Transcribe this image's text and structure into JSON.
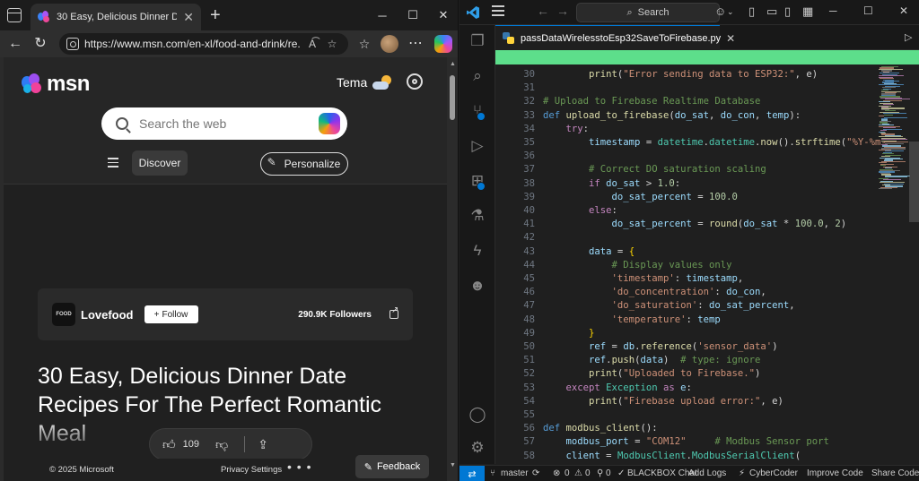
{
  "edge": {
    "tab_title": "30 Easy, Delicious Dinner Date Re",
    "url": "https://www.msn.com/en-xl/food-and-drink/re...",
    "window_controls": {
      "minimize": "─",
      "maximize": "☐",
      "close": "✕"
    },
    "msn": {
      "logo_text": "msn",
      "weather_label": "Tema",
      "search_placeholder": "Search the web",
      "discover_label": "Discover",
      "personalize_label": "Personalize",
      "publisher": {
        "logo_text": "FOOD",
        "name": "Lovefood",
        "follow_label": "Follow",
        "followers_count": "290.9K",
        "followers_label": "Followers"
      },
      "article_title": "30 Easy, Delicious Dinner Date Recipes For The Perfect Romantic Meal",
      "likes_count": "109",
      "copyright": "© 2025 Microsoft",
      "privacy": "Privacy Settings",
      "more": "• • •",
      "feedback": "Feedback"
    }
  },
  "vscode": {
    "search_label": "Search",
    "tab_title": "passDataWirelesstoEsp32SaveToFirebase.py",
    "code_lines": [
      {
        "n": "30",
        "tokens": [
          [
            "pl",
            "        "
          ],
          [
            "fn",
            "print"
          ],
          [
            "pl",
            "("
          ],
          [
            "str",
            "\"Error sending data to ESP32:\""
          ],
          [
            "pl",
            ", e)"
          ]
        ]
      },
      {
        "n": "31",
        "tokens": []
      },
      {
        "n": "32",
        "tokens": [
          [
            "cmt",
            "# Upload to Firebase Realtime Database"
          ]
        ]
      },
      {
        "n": "33",
        "tokens": [
          [
            "kw",
            "def "
          ],
          [
            "fn",
            "upload_to_firebase"
          ],
          [
            "pl",
            "("
          ],
          [
            "var",
            "do_sat"
          ],
          [
            "pl",
            ", "
          ],
          [
            "var",
            "do_con"
          ],
          [
            "pl",
            ", "
          ],
          [
            "var",
            "temp"
          ],
          [
            "pl",
            "):"
          ]
        ]
      },
      {
        "n": "34",
        "tokens": [
          [
            "pl",
            "    "
          ],
          [
            "ctl",
            "try"
          ],
          [
            "pl",
            ":"
          ]
        ]
      },
      {
        "n": "35",
        "tokens": [
          [
            "pl",
            "        "
          ],
          [
            "var",
            "timestamp"
          ],
          [
            "pl",
            " = "
          ],
          [
            "cls",
            "datetime"
          ],
          [
            "pl",
            "."
          ],
          [
            "cls",
            "datetime"
          ],
          [
            "pl",
            "."
          ],
          [
            "fn",
            "now"
          ],
          [
            "pl",
            "()."
          ],
          [
            "fn",
            "strftime"
          ],
          [
            "pl",
            "("
          ],
          [
            "str",
            "\"%Y-%m-"
          ]
        ]
      },
      {
        "n": "36",
        "tokens": []
      },
      {
        "n": "37",
        "tokens": [
          [
            "pl",
            "        "
          ],
          [
            "cmt",
            "# Correct DO saturation scaling"
          ]
        ]
      },
      {
        "n": "38",
        "tokens": [
          [
            "pl",
            "        "
          ],
          [
            "ctl",
            "if "
          ],
          [
            "var",
            "do_sat"
          ],
          [
            "pl",
            " > "
          ],
          [
            "num",
            "1.0"
          ],
          [
            "pl",
            ":"
          ]
        ]
      },
      {
        "n": "39",
        "tokens": [
          [
            "pl",
            "            "
          ],
          [
            "var",
            "do_sat_percent"
          ],
          [
            "pl",
            " = "
          ],
          [
            "num",
            "100.0"
          ]
        ]
      },
      {
        "n": "40",
        "tokens": [
          [
            "pl",
            "        "
          ],
          [
            "ctl",
            "else"
          ],
          [
            "pl",
            ":"
          ]
        ]
      },
      {
        "n": "41",
        "tokens": [
          [
            "pl",
            "            "
          ],
          [
            "var",
            "do_sat_percent"
          ],
          [
            "pl",
            " = "
          ],
          [
            "fn",
            "round"
          ],
          [
            "pl",
            "("
          ],
          [
            "var",
            "do_sat"
          ],
          [
            "pl",
            " * "
          ],
          [
            "num",
            "100.0"
          ],
          [
            "pl",
            ", "
          ],
          [
            "num",
            "2"
          ],
          [
            "pl",
            ")"
          ]
        ]
      },
      {
        "n": "42",
        "tokens": []
      },
      {
        "n": "43",
        "tokens": [
          [
            "pl",
            "        "
          ],
          [
            "var",
            "data"
          ],
          [
            "pl",
            " = "
          ],
          [
            "br",
            "{"
          ]
        ]
      },
      {
        "n": "44",
        "tokens": [
          [
            "pl",
            "            "
          ],
          [
            "cmt",
            "# Display values only"
          ]
        ]
      },
      {
        "n": "45",
        "tokens": [
          [
            "pl",
            "            "
          ],
          [
            "str",
            "'timestamp'"
          ],
          [
            "pl",
            ": "
          ],
          [
            "var",
            "timestamp"
          ],
          [
            "pl",
            ","
          ]
        ]
      },
      {
        "n": "46",
        "tokens": [
          [
            "pl",
            "            "
          ],
          [
            "str",
            "'do_concentration'"
          ],
          [
            "pl",
            ": "
          ],
          [
            "var",
            "do_con"
          ],
          [
            "pl",
            ","
          ]
        ]
      },
      {
        "n": "47",
        "tokens": [
          [
            "pl",
            "            "
          ],
          [
            "str",
            "'do_saturation'"
          ],
          [
            "pl",
            ": "
          ],
          [
            "var",
            "do_sat_percent"
          ],
          [
            "pl",
            ","
          ]
        ]
      },
      {
        "n": "48",
        "tokens": [
          [
            "pl",
            "            "
          ],
          [
            "str",
            "'temperature'"
          ],
          [
            "pl",
            ": "
          ],
          [
            "var",
            "temp"
          ]
        ]
      },
      {
        "n": "49",
        "tokens": [
          [
            "pl",
            "        "
          ],
          [
            "br",
            "}"
          ]
        ]
      },
      {
        "n": "50",
        "tokens": [
          [
            "pl",
            "        "
          ],
          [
            "var",
            "ref"
          ],
          [
            "pl",
            " = "
          ],
          [
            "var",
            "db"
          ],
          [
            "pl",
            "."
          ],
          [
            "fn",
            "reference"
          ],
          [
            "pl",
            "("
          ],
          [
            "str",
            "'sensor_data'"
          ],
          [
            "pl",
            ")"
          ]
        ]
      },
      {
        "n": "51",
        "tokens": [
          [
            "pl",
            "        "
          ],
          [
            "var",
            "ref"
          ],
          [
            "pl",
            "."
          ],
          [
            "fn",
            "push"
          ],
          [
            "pl",
            "("
          ],
          [
            "var",
            "data"
          ],
          [
            "pl",
            ")  "
          ],
          [
            "cmt",
            "# type: ignore"
          ]
        ]
      },
      {
        "n": "52",
        "tokens": [
          [
            "pl",
            "        "
          ],
          [
            "fn",
            "print"
          ],
          [
            "pl",
            "("
          ],
          [
            "str",
            "\"Uploaded to Firebase.\""
          ],
          [
            "pl",
            ")"
          ]
        ]
      },
      {
        "n": "53",
        "tokens": [
          [
            "pl",
            "    "
          ],
          [
            "ctl",
            "except "
          ],
          [
            "cls",
            "Exception "
          ],
          [
            "ctl",
            "as "
          ],
          [
            "var",
            "e"
          ],
          [
            "pl",
            ":"
          ]
        ]
      },
      {
        "n": "54",
        "tokens": [
          [
            "pl",
            "        "
          ],
          [
            "fn",
            "print"
          ],
          [
            "pl",
            "("
          ],
          [
            "str",
            "\"Firebase upload error:\""
          ],
          [
            "pl",
            ", e)"
          ]
        ]
      },
      {
        "n": "55",
        "tokens": []
      },
      {
        "n": "56",
        "tokens": [
          [
            "kw",
            "def "
          ],
          [
            "fn",
            "modbus_client"
          ],
          [
            "pl",
            "():"
          ]
        ]
      },
      {
        "n": "57",
        "tokens": [
          [
            "pl",
            "    "
          ],
          [
            "var",
            "modbus_port"
          ],
          [
            "pl",
            " = "
          ],
          [
            "str",
            "\"COM12\""
          ],
          [
            "pl",
            "     "
          ],
          [
            "cmt",
            "# Modbus Sensor port"
          ]
        ]
      },
      {
        "n": "58",
        "tokens": [
          [
            "pl",
            "    "
          ],
          [
            "var",
            "client"
          ],
          [
            "pl",
            " = "
          ],
          [
            "cls",
            "ModbusClient"
          ],
          [
            "pl",
            "."
          ],
          [
            "cls",
            "ModbusSerialClient"
          ],
          [
            "pl",
            "("
          ]
        ]
      }
    ],
    "status": {
      "branch": "master",
      "errors": "0",
      "warnings": "0",
      "ports": "0",
      "blackbox": "BLACKBOX Chat",
      "add_logs": "Add Logs",
      "cybercoder": "CyberCoder",
      "improve_code": "Improve Code",
      "share_code": "Share Code"
    },
    "colors": {
      "accent": "#0078d4",
      "notify": "#5dde8b"
    }
  }
}
